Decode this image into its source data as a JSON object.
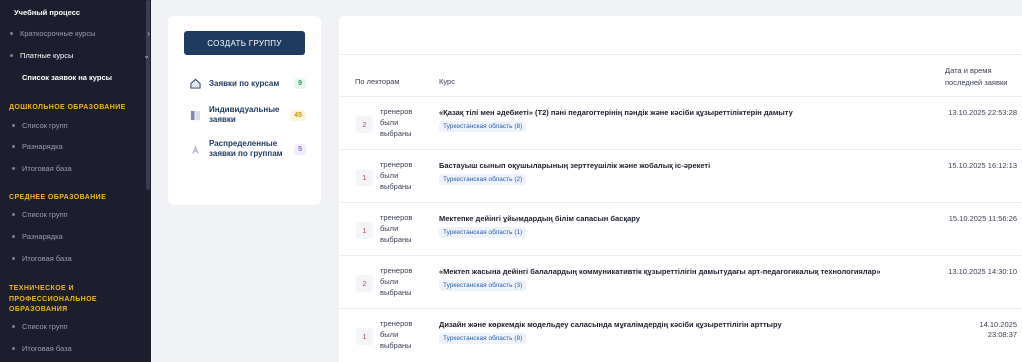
{
  "sidebar": {
    "top_item": "Учебный процесс",
    "short_courses": "Краткосрочные курсы",
    "paid_courses": "Платные курсы",
    "current": "Список заявок на курсы",
    "sections": [
      {
        "title": "ДОШКОЛЬНОЕ ОБРАЗОВАНИЕ",
        "items": [
          "Список групп",
          "Разнарядка",
          "Итоговая база"
        ]
      },
      {
        "title": "СРЕДНЕЕ ОБРАЗОВАНИЕ",
        "items": [
          "Список групп",
          "Разнарядка",
          "Итоговая база"
        ]
      },
      {
        "title": "ТЕХНИЧЕСКОЕ И ПРОФЕССИОНАЛЬНОЕ ОБРАЗОВАНИЯ",
        "items": [
          "Список групп",
          "Итоговая база"
        ]
      }
    ]
  },
  "left_panel": {
    "create_button": "СОЗДАТЬ ГРУППУ",
    "items": [
      {
        "label": "Заявки по курсам",
        "badge": "9",
        "icon": "home-icon"
      },
      {
        "label": "Индивидуальные заявки",
        "badge": "45",
        "icon": "document-icon"
      },
      {
        "label": "Распределенные заявки по группам",
        "badge": "5",
        "icon": "pointer-icon"
      }
    ]
  },
  "table": {
    "headers": {
      "lecturers": "По лекторам",
      "course": "Курс",
      "date": "Дата и время последней заявки"
    },
    "rows": [
      {
        "count": "2",
        "lect_text": "тренеров были выбраны",
        "course": "«Қазақ тілі мен әдебиеті» (Т2) пәні педагогтерінің пәндік және кәсіби құзыреттіліктерін дамыту",
        "region": "Туркестанская область (8)",
        "date": "13.10.2025 22:53:28"
      },
      {
        "count": "1",
        "lect_text": "тренеров были выбраны",
        "course": "Бастауыш сынып оқушыларының зерттеушілік және жобалық іс-әрекеті",
        "region": "Туркестанская область (2)",
        "date": "15.10.2025 16:12:13"
      },
      {
        "count": "1",
        "lect_text": "тренеров были выбраны",
        "course": "Мектепке дейінгі ұйымдардың білім сапасын басқару",
        "region": "Туркестанская область (1)",
        "date": "15.10.2025 11:56:26"
      },
      {
        "count": "2",
        "lect_text": "тренеров были выбраны",
        "course": "«Мектеп жасына дейінгі балалардың коммуникативтік құзыреттілігін дамытудағы арт-педагогикалық технологиялар»",
        "region": "Туркестанская область (3)",
        "date": "13.10.2025 14:30:10"
      },
      {
        "count": "1",
        "lect_text": "тренеров были выбраны",
        "course": "Дизайн және көркемдік модельдеу саласында мұғалімдердің кәсіби құзыреттілігін арттыру",
        "region": "Туркестанская область (8)",
        "date": "14.10.2025 23:08:37"
      }
    ]
  }
}
